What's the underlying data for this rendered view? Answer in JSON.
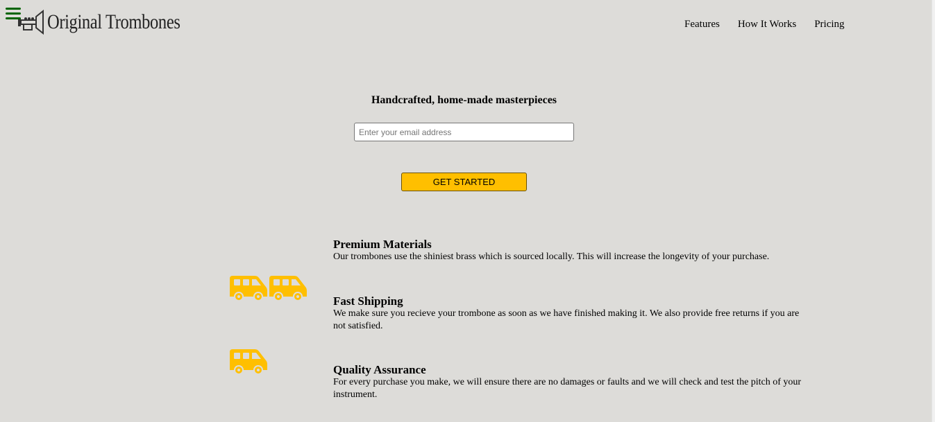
{
  "header": {
    "logo_text": "Original Trombones",
    "logo_icon": "trumpet-logo-icon",
    "menu_icon": "hamburger-menu-icon",
    "nav": [
      {
        "label": "Features"
      },
      {
        "label": "How It Works"
      },
      {
        "label": "Pricing"
      }
    ]
  },
  "hero": {
    "title": "Handcrafted, home-made masterpieces",
    "email_placeholder": "Enter your email address",
    "cta_label": "GET STARTED"
  },
  "features": [
    {
      "title": "Premium Materials",
      "text": "Our trombones use the shiniest brass which is sourced locally. This will increase the longevity of your purchase."
    },
    {
      "title": "Fast Shipping",
      "text": "We make sure you recieve your trombone as soon as we have finished making it. We also provide free returns if you are not satisfied."
    },
    {
      "title": "Quality Assurance",
      "text": "For every purchase you make, we will ensure there are no damages or faults and we will check and test the pitch of your instrument."
    }
  ],
  "colors": {
    "background": "#dddcd9",
    "accent": "#ffbf00",
    "menu_icon": "#006400"
  },
  "icons": [
    "van-icon",
    "van-icon",
    "van-icon"
  ]
}
